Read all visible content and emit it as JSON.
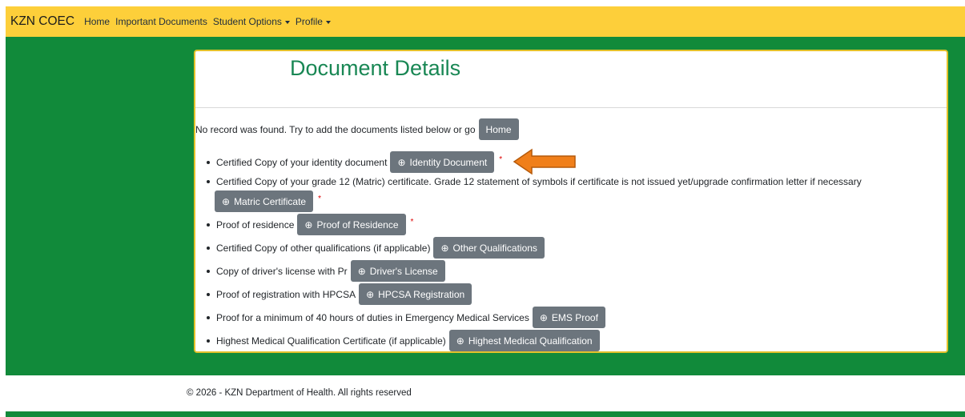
{
  "navbar": {
    "brand": "KZN COEC",
    "items": [
      {
        "label": "Home"
      },
      {
        "label": "Important Documents"
      },
      {
        "label": "Student Options"
      },
      {
        "label": "Profile"
      }
    ]
  },
  "card": {
    "title": "Document Details",
    "no_record_text": "No record was found. Try to add the documents listed below or go",
    "home_button": "Home"
  },
  "documents": [
    {
      "text": "Certified Copy of your identity document",
      "button": "Identity Document",
      "required": "*"
    },
    {
      "text": "Certified Copy of your grade 12 (Matric) certificate. Grade 12 statement of symbols if certificate is not issued yet/upgrade confirmation letter if necessary",
      "button": "Matric Certificate",
      "required": "*"
    },
    {
      "text": "Proof of residence",
      "button": "Proof of Residence",
      "required": "*"
    },
    {
      "text": "Certified Copy of other qualifications (if applicable)",
      "button": "Other Qualifications"
    },
    {
      "text": "Copy of driver's license with Pr",
      "button": "Driver's License"
    },
    {
      "text": "Proof of registration with HPCSA",
      "button": "HPCSA Registration"
    },
    {
      "text": "Proof for a minimum of 40 hours of duties in Emergency Medical Services",
      "button": "EMS Proof"
    },
    {
      "text": "Highest Medical Qualification Certificate (if applicable)",
      "button": "Highest Medical Qualification"
    }
  ],
  "footer": {
    "text": "© 2026 - KZN Department of Health. All rights reserved"
  },
  "colors": {
    "navbar": "#fdcf3a",
    "green": "#118a3a",
    "title": "#198754",
    "button": "#6c757d",
    "arrow": "#f07f1a"
  },
  "icons": {
    "add": "plus-circle-icon",
    "arrow": "arrow-left-icon"
  }
}
